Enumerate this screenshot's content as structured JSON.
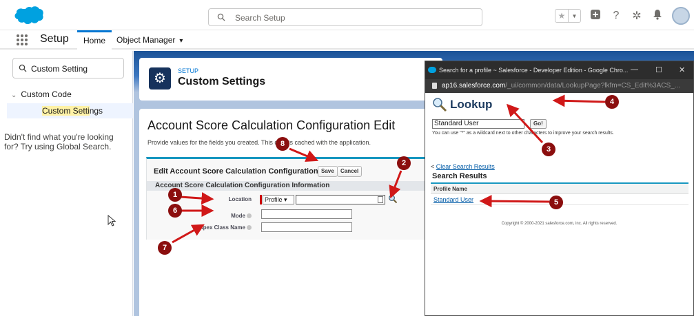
{
  "header": {
    "search_placeholder": "Search Setup",
    "icons": [
      "salesforce-logo",
      "favorites-star-icon",
      "favorites-list-icon",
      "global-actions-plus-icon",
      "help-icon",
      "setup-gear-icon",
      "notifications-bell-icon",
      "user-avatar"
    ]
  },
  "nav": {
    "app_name": "Setup",
    "tabs": [
      {
        "label": "Home"
      },
      {
        "label": "Object Manager"
      }
    ]
  },
  "sidebar": {
    "search_value": "Custom Setting",
    "tree_node": "Custom Code",
    "tree_item_prefix": "Custom Setti",
    "tree_item_highlight": "ngs",
    "help_text": "Didn't find what you're looking for? Try using Global Search."
  },
  "setup_header": {
    "kicker": "SETUP",
    "title": "Custom Settings"
  },
  "edit_page": {
    "heading": "Account Score Calculation Configuration Edit",
    "description": "Provide values for the fields you created. This data is cached with the application.",
    "block_title": "Edit Account Score Calculation Configuration",
    "save_label": "Save",
    "cancel_label": "Cancel",
    "section_title": "Account Score Calculation Configuration Information",
    "fields": {
      "location_label": "Location",
      "location_select": "Profile",
      "mode_label": "Mode",
      "apex_label": "Apex Class Name"
    }
  },
  "popup": {
    "window_title": "Search for a profile ~ Salesforce - Developer Edition - Google Chro...",
    "minimize": "—",
    "maximize": "☐",
    "close": "✕",
    "url_domain": "ap16.salesforce.com",
    "url_path": "/_ui/common/data/LookupPage?lkfm=CS_Edit%3ACS_...",
    "lookup_title": "Lookup",
    "search_value": "Standard User",
    "go_label": "Go!",
    "wildcard_note": "You can use \"*\" as a wildcard next to other characters to improve your search results.",
    "clear_prefix": "< ",
    "clear_link": "Clear Search Results",
    "results_title": "Search Results",
    "results_column": "Profile Name",
    "results": [
      "Standard User"
    ],
    "copyright": "Copyright © 2000-2021 salesforce.com, inc. All rights reserved."
  },
  "annotations": {
    "color": "#8b0e0e",
    "badges": [
      "1",
      "2",
      "3",
      "4",
      "5",
      "6",
      "7",
      "8"
    ]
  }
}
